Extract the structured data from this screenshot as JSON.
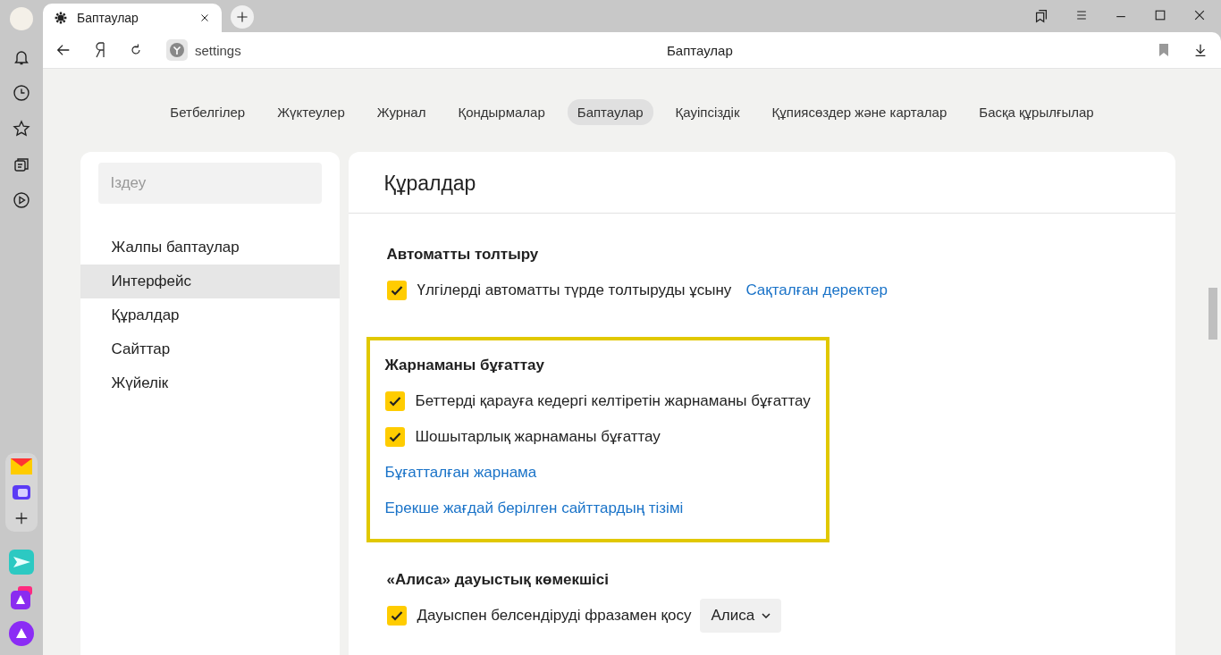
{
  "browser": {
    "tab_title": "Баптаулар",
    "address": "settings",
    "page_title": "Баптаулар"
  },
  "nav": [
    {
      "label": "Бетбелгілер",
      "selected": false
    },
    {
      "label": "Жүктеулер",
      "selected": false
    },
    {
      "label": "Журнал",
      "selected": false
    },
    {
      "label": "Қондырмалар",
      "selected": false
    },
    {
      "label": "Баптаулар",
      "selected": true
    },
    {
      "label": "Қауіпсіздік",
      "selected": false
    },
    {
      "label": "Құпиясөздер және карталар",
      "selected": false
    },
    {
      "label": "Басқа құрылғылар",
      "selected": false
    }
  ],
  "search": {
    "placeholder": "Іздеу"
  },
  "sidebar": {
    "items": [
      {
        "label": "Жалпы баптаулар",
        "selected": false
      },
      {
        "label": "Интерфейс",
        "selected": true
      },
      {
        "label": "Құралдар",
        "selected": false
      },
      {
        "label": "Сайттар",
        "selected": false
      },
      {
        "label": "Жүйелік",
        "selected": false
      }
    ]
  },
  "panel": {
    "title": "Құралдар",
    "groups": [
      {
        "title": "Автоматты толтыру",
        "highlighted": false,
        "items": [
          {
            "kind": "checkbox",
            "label": "Үлгілерді автоматты түрде толтыруды ұсыну",
            "checked": true,
            "link": "Сақталған деректер"
          }
        ]
      },
      {
        "title": "Жарнаманы бұғаттау",
        "highlighted": true,
        "items": [
          {
            "kind": "checkbox",
            "label": "Беттерді қарауға кедергі келтіретін жарнаманы бұғаттау",
            "checked": true
          },
          {
            "kind": "checkbox",
            "label": "Шошытарлық жарнаманы бұғаттау",
            "checked": true
          },
          {
            "kind": "link",
            "label": "Бұғатталған жарнама"
          },
          {
            "kind": "link",
            "label": "Ерекше жағдай берілген сайттардың тізімі"
          }
        ]
      },
      {
        "title": "«Алиса» дауыстық көмекшісі",
        "highlighted": false,
        "items": [
          {
            "kind": "checkbox",
            "label": "Дауыспен белсендіруді фразамен қосу",
            "checked": true,
            "select": "Алиса"
          }
        ]
      }
    ]
  }
}
